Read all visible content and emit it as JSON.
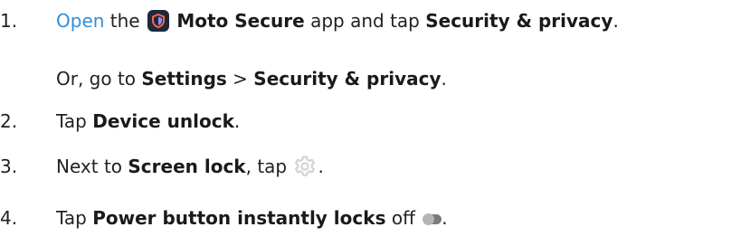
{
  "steps": [
    {
      "number": "1.",
      "parts": {
        "link": "Open",
        "t1": " the ",
        "app_name": "Moto Secure",
        "t2": " app and tap ",
        "b1": "Security & privacy",
        "t3": "."
      },
      "sub": {
        "t1": "Or, go to ",
        "b1": "Settings",
        "t2": " > ",
        "b2": "Security & privacy",
        "t3": "."
      }
    },
    {
      "number": "2.",
      "parts": {
        "t1": "Tap ",
        "b1": "Device unlock",
        "t2": "."
      }
    },
    {
      "number": "3.",
      "parts": {
        "t1": "Next to ",
        "b1": "Screen lock",
        "t2": ", tap ",
        "t3": "."
      }
    },
    {
      "number": "4.",
      "parts": {
        "t1": "Tap ",
        "b1": "Power button instantly locks",
        "t2": " off ",
        "t3": "."
      }
    }
  ],
  "icons": {
    "app": "moto-secure-shield-icon",
    "settings": "gear-icon",
    "toggle": "toggle-off-icon"
  },
  "colors": {
    "link": "#2f8fd8",
    "text": "#222222",
    "app_icon_bg": "#1e2a39",
    "app_icon_accent": "#f0675a"
  }
}
